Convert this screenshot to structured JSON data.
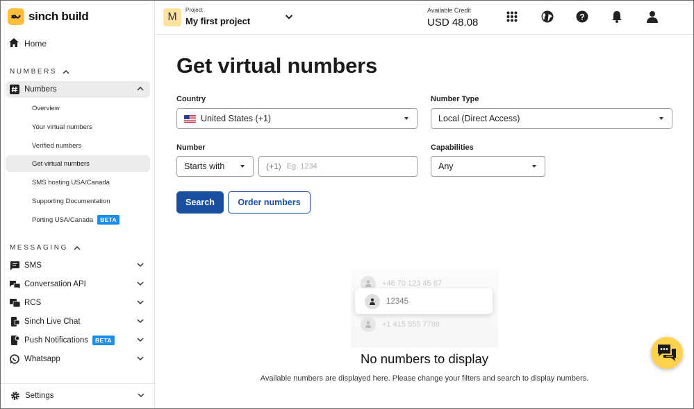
{
  "brand": {
    "name": "sinch build"
  },
  "sidebar": {
    "home": "Home",
    "numbers_section": "NUMBERS",
    "numbers_label": "Numbers",
    "sub_items": [
      {
        "label": "Overview"
      },
      {
        "label": "Your virtual numbers"
      },
      {
        "label": "Verified numbers"
      },
      {
        "label": "Get virtual numbers"
      },
      {
        "label": "SMS hosting USA/Canada"
      },
      {
        "label": "Supporting Documentation"
      },
      {
        "label": "Porting USA/Canada",
        "badge": "BETA"
      }
    ],
    "messaging_section": "MESSAGING",
    "messaging_items": [
      {
        "label": "SMS"
      },
      {
        "label": "Conversation API"
      },
      {
        "label": "RCS"
      },
      {
        "label": "Sinch Live Chat"
      },
      {
        "label": "Push Notifications",
        "badge": "BETA"
      },
      {
        "label": "Whatsapp"
      }
    ],
    "settings": "Settings"
  },
  "topbar": {
    "project_initial": "M",
    "project_label": "Project",
    "project_name": "My first project",
    "credit_label": "Available Credit",
    "credit_value": "USD 48.08"
  },
  "main": {
    "title": "Get virtual numbers",
    "country": {
      "label": "Country",
      "value": "United States (+1)"
    },
    "number_type": {
      "label": "Number Type",
      "value": "Local (Direct Access)"
    },
    "number": {
      "label": "Number",
      "match": "Starts with",
      "prefix": "(+1)",
      "placeholder": "Eg. 1234"
    },
    "capabilities": {
      "label": "Capabilities",
      "value": "Any"
    },
    "search_button": "Search",
    "order_button": "Order numbers",
    "illustration": [
      "+46 70 123 45 67",
      "12345",
      "+1 415 555 7788"
    ],
    "empty_title": "No numbers to display",
    "empty_desc": "Available numbers are displayed here. Please change your filters and search to display numbers."
  },
  "colors": {
    "brand": "#ffbe3c",
    "primary": "#1a4fa0",
    "beta": "#1f8ee8",
    "chat": "#ffd24d"
  }
}
